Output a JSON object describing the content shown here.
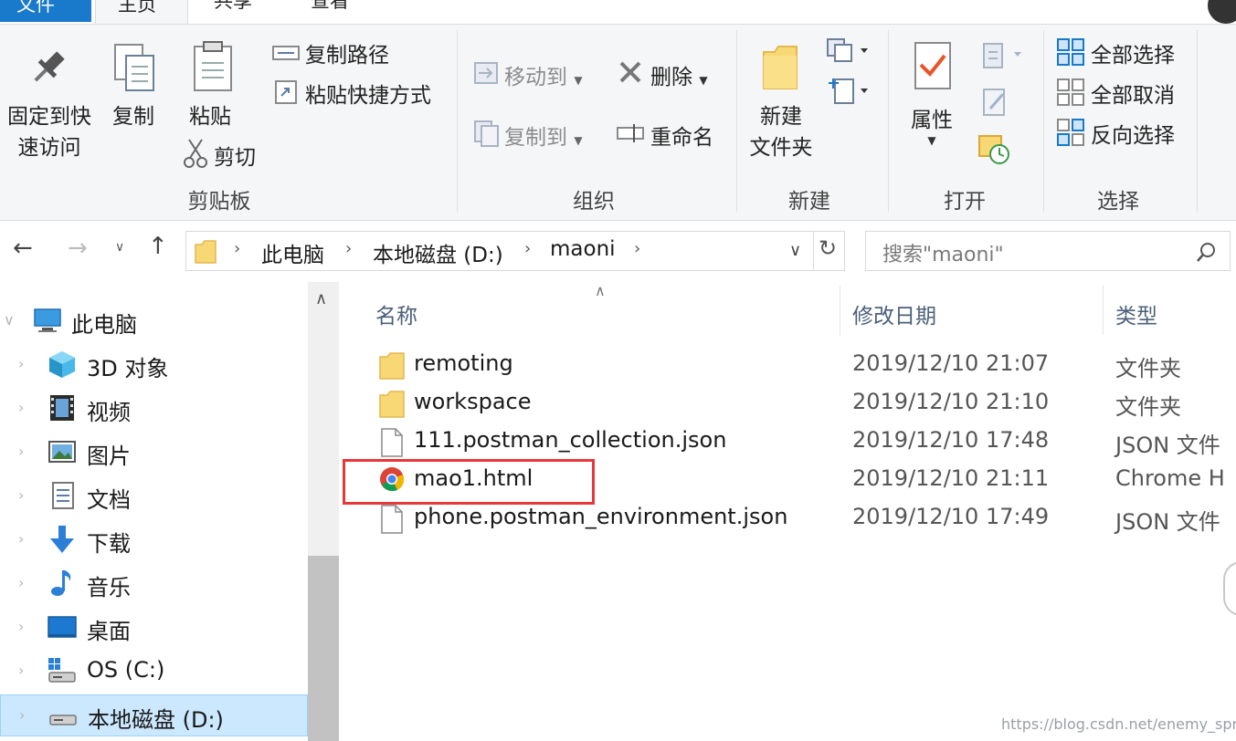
{
  "tabs": {
    "file": "文件",
    "home": "主页",
    "share": "共享",
    "view": "查看"
  },
  "ribbon": {
    "clipboard": {
      "pin_label_1": "固定到快",
      "pin_label_2": "速访问",
      "copy": "复制",
      "paste": "粘贴",
      "copy_path": "复制路径",
      "paste_shortcut": "粘贴快捷方式",
      "cut": "剪切",
      "group": "剪贴板"
    },
    "organize": {
      "move_to": "移动到",
      "copy_to": "复制到",
      "delete": "删除",
      "rename": "重命名",
      "group": "组织"
    },
    "new": {
      "new_folder_1": "新建",
      "new_folder_2": "文件夹",
      "group": "新建"
    },
    "open": {
      "properties": "属性",
      "group": "打开"
    },
    "select": {
      "select_all": "全部选择",
      "select_none": "全部取消",
      "invert": "反向选择",
      "group": "选择"
    }
  },
  "address": {
    "crumbs": [
      "此电脑",
      "本地磁盘 (D:)",
      "maoni"
    ],
    "search_placeholder": "搜索\"maoni\""
  },
  "nav": {
    "items": [
      {
        "label": "此电脑",
        "icon": "computer-icon"
      },
      {
        "label": "3D 对象",
        "icon": "3d-objects-icon"
      },
      {
        "label": "视频",
        "icon": "video-icon"
      },
      {
        "label": "图片",
        "icon": "pictures-icon"
      },
      {
        "label": "文档",
        "icon": "documents-icon"
      },
      {
        "label": "下载",
        "icon": "download-icon"
      },
      {
        "label": "音乐",
        "icon": "music-icon"
      },
      {
        "label": "桌面",
        "icon": "desktop-icon"
      },
      {
        "label": "OS (C:)",
        "icon": "drive-c-icon"
      },
      {
        "label": "本地磁盘 (D:)",
        "icon": "drive-d-icon"
      }
    ]
  },
  "list": {
    "columns": {
      "name": "名称",
      "date": "修改日期",
      "type": "类型"
    },
    "rows": [
      {
        "name": "remoting",
        "date": "2019/12/10 21:07",
        "type": "文件夹",
        "icon": "folder-icon"
      },
      {
        "name": "workspace",
        "date": "2019/12/10 21:10",
        "type": "文件夹",
        "icon": "folder-icon"
      },
      {
        "name": "111.postman_collection.json",
        "date": "2019/12/10 17:48",
        "type": "JSON 文件",
        "icon": "file-icon"
      },
      {
        "name": "mao1.html",
        "date": "2019/12/10 21:11",
        "type": "Chrome H",
        "icon": "chrome-icon"
      },
      {
        "name": "phone.postman_environment.json",
        "date": "2019/12/10 17:49",
        "type": "JSON 文件",
        "icon": "file-icon"
      }
    ]
  },
  "watermark": "https://blog.csdn.net/enemy_sprites",
  "colors": {
    "accent": "#1979ca",
    "selection": "#cce8ff",
    "highlight": "#e8373a",
    "folder": "#f8d775"
  }
}
